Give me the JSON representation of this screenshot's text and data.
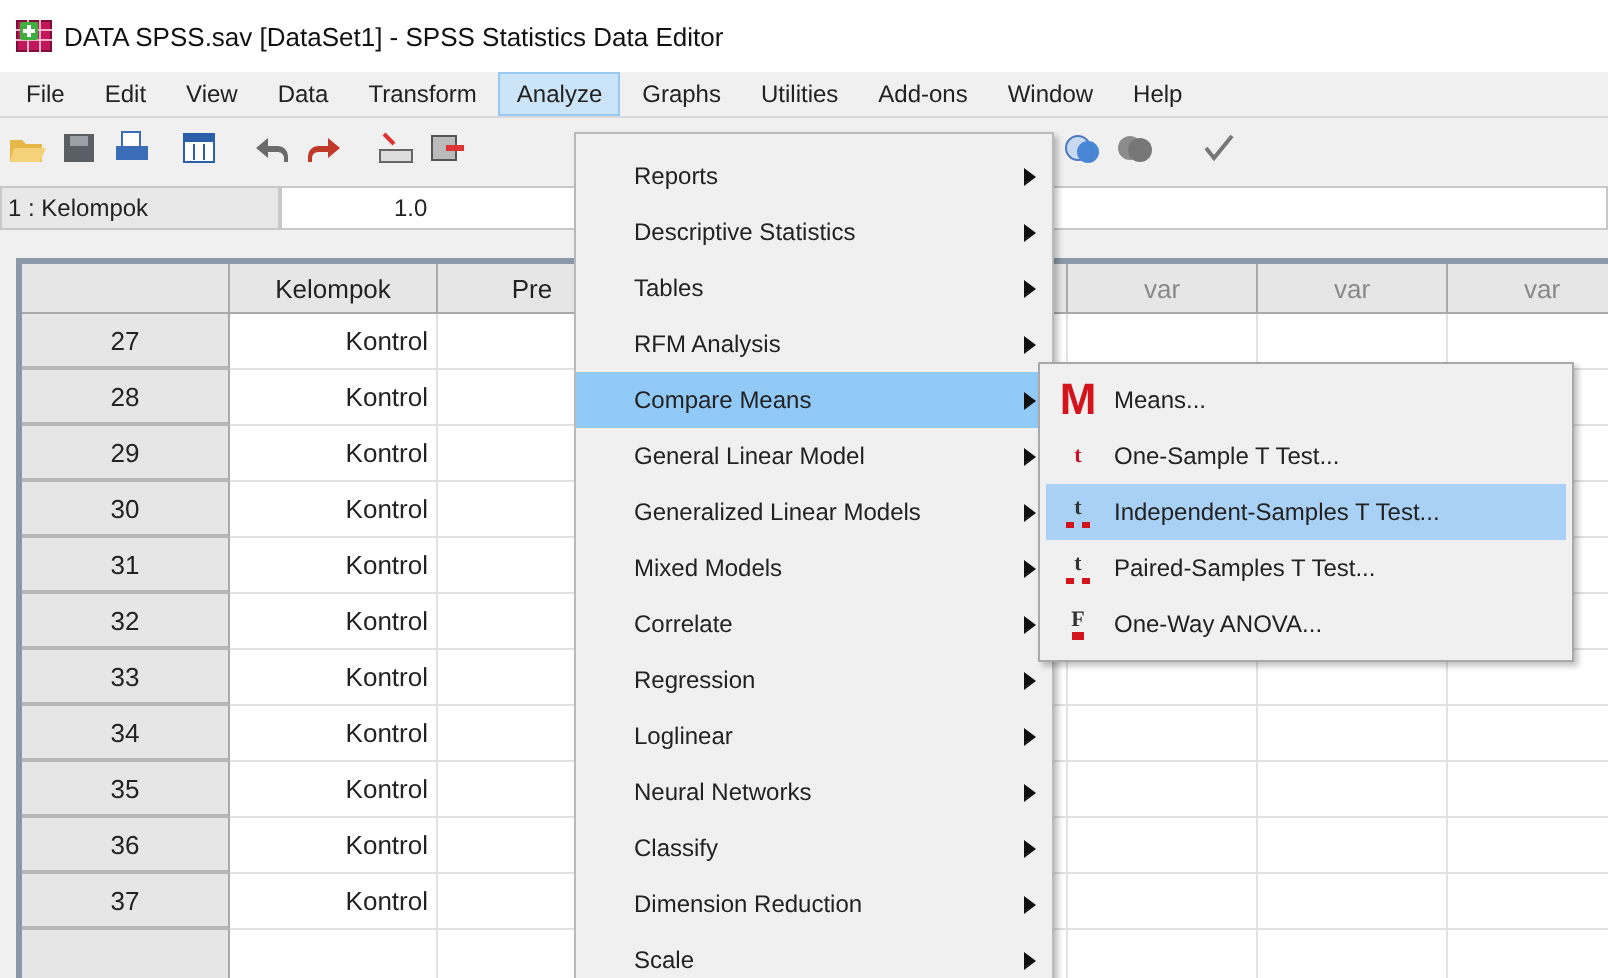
{
  "window": {
    "title": "DATA SPSS.sav [DataSet1] - SPSS Statistics Data Editor"
  },
  "menu_bar": [
    {
      "label": "File",
      "selected": false
    },
    {
      "label": "Edit",
      "selected": false
    },
    {
      "label": "View",
      "selected": false
    },
    {
      "label": "Data",
      "selected": false
    },
    {
      "label": "Transform",
      "selected": false
    },
    {
      "label": "Analyze",
      "selected": true
    },
    {
      "label": "Graphs",
      "selected": false
    },
    {
      "label": "Utilities",
      "selected": false
    },
    {
      "label": "Add-ons",
      "selected": false
    },
    {
      "label": "Window",
      "selected": false
    },
    {
      "label": "Help",
      "selected": false
    }
  ],
  "cell_editor": {
    "variable": "1 : Kelompok",
    "value": "1.0"
  },
  "grid": {
    "columns": [
      "Kelompok",
      "Pre",
      "var",
      "var",
      "var"
    ],
    "rows": [
      {
        "number": "27",
        "kelompok": "Kontrol"
      },
      {
        "number": "28",
        "kelompok": "Kontrol"
      },
      {
        "number": "29",
        "kelompok": "Kontrol"
      },
      {
        "number": "30",
        "kelompok": "Kontrol"
      },
      {
        "number": "31",
        "kelompok": "Kontrol"
      },
      {
        "number": "32",
        "kelompok": "Kontrol"
      },
      {
        "number": "33",
        "kelompok": "Kontrol"
      },
      {
        "number": "34",
        "kelompok": "Kontrol"
      },
      {
        "number": "35",
        "kelompok": "Kontrol"
      },
      {
        "number": "36",
        "kelompok": "Kontrol"
      },
      {
        "number": "37",
        "kelompok": "Kontrol"
      }
    ]
  },
  "analyze_menu": [
    {
      "label": "Reports",
      "selected": false
    },
    {
      "label": "Descriptive Statistics",
      "selected": false
    },
    {
      "label": "Tables",
      "selected": false
    },
    {
      "label": "RFM Analysis",
      "selected": false
    },
    {
      "label": "Compare Means",
      "selected": true
    },
    {
      "label": "General Linear Model",
      "selected": false
    },
    {
      "label": "Generalized Linear Models",
      "selected": false
    },
    {
      "label": "Mixed Models",
      "selected": false
    },
    {
      "label": "Correlate",
      "selected": false
    },
    {
      "label": "Regression",
      "selected": false
    },
    {
      "label": "Loglinear",
      "selected": false
    },
    {
      "label": "Neural Networks",
      "selected": false
    },
    {
      "label": "Classify",
      "selected": false
    },
    {
      "label": "Dimension Reduction",
      "selected": false
    },
    {
      "label": "Scale",
      "selected": false
    }
  ],
  "compare_means_menu": [
    {
      "label": "Means...",
      "kind": "means",
      "icon_text": "M",
      "selected": false
    },
    {
      "label": "One-Sample T Test...",
      "kind": "t",
      "icon_text": "t",
      "selected": false
    },
    {
      "label": "Independent-Samples T Test...",
      "kind": "t2",
      "icon_text": "t",
      "selected": true
    },
    {
      "label": "Paired-Samples T Test...",
      "kind": "t2",
      "icon_text": "t",
      "selected": false
    },
    {
      "label": "One-Way ANOVA...",
      "kind": "f",
      "icon_text": "F",
      "selected": false
    }
  ]
}
